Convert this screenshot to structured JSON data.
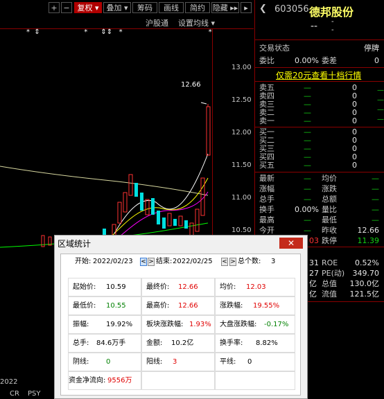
{
  "toolbar": {
    "plus": "+",
    "minus": "−",
    "fuquan": "复权",
    "fuquan_arrow": "▾",
    "diejia": "叠加",
    "diejia_arrow": "▾",
    "chouma": "筹码",
    "huaxian": "画线",
    "jianyue": "简约",
    "yincang": "隐藏",
    "yincang_arrow": "▸▸"
  },
  "chart": {
    "index_label": "沪股通",
    "settings_label": "设置均线",
    "settings_arrow": "▾",
    "price_ticks": [
      "13.00",
      "12.50",
      "12.00",
      "11.50",
      "11.00",
      "10.50"
    ],
    "high_label": "12.66",
    "star_markers": "*  ⇕                    *      ⇕⇕   *                                       *",
    "bottom_tabs": [
      "CR",
      "PSY"
    ],
    "year_label": "2022",
    "colors": {
      "up": "#ff3232",
      "down": "#00e0e0",
      "ma5": "#ffffff",
      "ma10": "#ffff00",
      "ma20": "#ff00ff",
      "ma60": "#00ff00",
      "ma120": "#d8d8a0"
    }
  },
  "quote": {
    "back_arrow": "❮",
    "code": "603056",
    "name": "德邦股份",
    "price_dash": "--",
    "price_small": "-",
    "trade_status_label": "交易状态",
    "trade_status_value": "停牌",
    "weibi_label": "委比",
    "weibi_value": "0.00%",
    "weicha_label": "委差",
    "weicha_value": "0",
    "promo": "仅需20元查看十档行情",
    "asks": [
      {
        "label": "卖五",
        "price": "—",
        "vol": "0"
      },
      {
        "label": "卖四",
        "price": "—",
        "vol": "0"
      },
      {
        "label": "卖三",
        "price": "—",
        "vol": "0"
      },
      {
        "label": "卖二",
        "price": "—",
        "vol": "0"
      },
      {
        "label": "卖一",
        "price": "—",
        "vol": "0"
      }
    ],
    "bids": [
      {
        "label": "买一",
        "price": "—",
        "vol": "0"
      },
      {
        "label": "买二",
        "price": "—",
        "vol": "0"
      },
      {
        "label": "买三",
        "price": "—",
        "vol": "0"
      },
      {
        "label": "买四",
        "price": "—",
        "vol": "0"
      },
      {
        "label": "买五",
        "price": "—",
        "vol": "0"
      }
    ],
    "stats": [
      {
        "l1": "最新",
        "v1": "—",
        "l2": "均价",
        "v2": "—"
      },
      {
        "l1": "涨幅",
        "v1": "—",
        "l2": "涨跌",
        "v2": "—"
      },
      {
        "l1": "总手",
        "v1": "—",
        "l2": "总额",
        "v2": "—"
      },
      {
        "l1": "换手",
        "v1": "0.00%",
        "l2": "量比",
        "v2": "—"
      },
      {
        "l1": "最高",
        "v1": "—",
        "l2": "最低",
        "v2": "—"
      },
      {
        "l1": "今开",
        "v1": "—",
        "l2": "昨收",
        "v2": "12.66"
      },
      {
        "l1": "",
        "v1": "03",
        "l2": "跌停",
        "v2": "11.39"
      },
      {
        "l1": "",
        "v1": "31",
        "l2": "ROE",
        "v2": "0.52%"
      },
      {
        "l1": "",
        "v1": "27",
        "l2": "PE(动)",
        "v2": "349.70"
      },
      {
        "l1": "",
        "v1": "亿",
        "l2": "总值",
        "v2": "130.0亿"
      },
      {
        "l1": "",
        "v1": "亿",
        "l2": "流值",
        "v2": "121.5亿"
      }
    ],
    "side_markers": [
      "—",
      "—",
      "—",
      "—"
    ]
  },
  "dialog": {
    "title": "区域统计",
    "close": "✕",
    "start_label": "开始:",
    "start_date": "2022/02/23",
    "end_label": "结束:",
    "end_date": "2022/02/25",
    "count_label": "总个数:",
    "count_value": "3",
    "arrow_left": "<",
    "arrow_right": ">",
    "cells": [
      {
        "k": "起始价:",
        "v": "10.59",
        "c": "black"
      },
      {
        "k": "最终价:",
        "v": "12.66",
        "c": "red"
      },
      {
        "k": "均价:",
        "v": "12.03",
        "c": "red"
      },
      {
        "k": "最低价:",
        "v": "10.55",
        "c": "green"
      },
      {
        "k": "最高价:",
        "v": "12.66",
        "c": "red"
      },
      {
        "k": "涨跌幅:",
        "v": "19.55%",
        "c": "red"
      },
      {
        "k": "振幅:",
        "v": "19.92%",
        "c": "black"
      },
      {
        "k": "板块涨跌幅:",
        "v": "1.93%",
        "c": "red"
      },
      {
        "k": "大盘涨跌幅:",
        "v": "-0.17%",
        "c": "green"
      },
      {
        "k": "总手:",
        "v": "84.6万手",
        "c": "black"
      },
      {
        "k": "金额:",
        "v": "10.2亿",
        "c": "black"
      },
      {
        "k": "换手率:",
        "v": "8.82%",
        "c": "black"
      },
      {
        "k": "阴线:",
        "v": "0",
        "c": "green"
      },
      {
        "k": "阳线:",
        "v": "3",
        "c": "red"
      },
      {
        "k": "平线:",
        "v": "0",
        "c": "black"
      },
      {
        "k": "资金净流向:",
        "v": "9556万",
        "c": "red"
      }
    ]
  }
}
